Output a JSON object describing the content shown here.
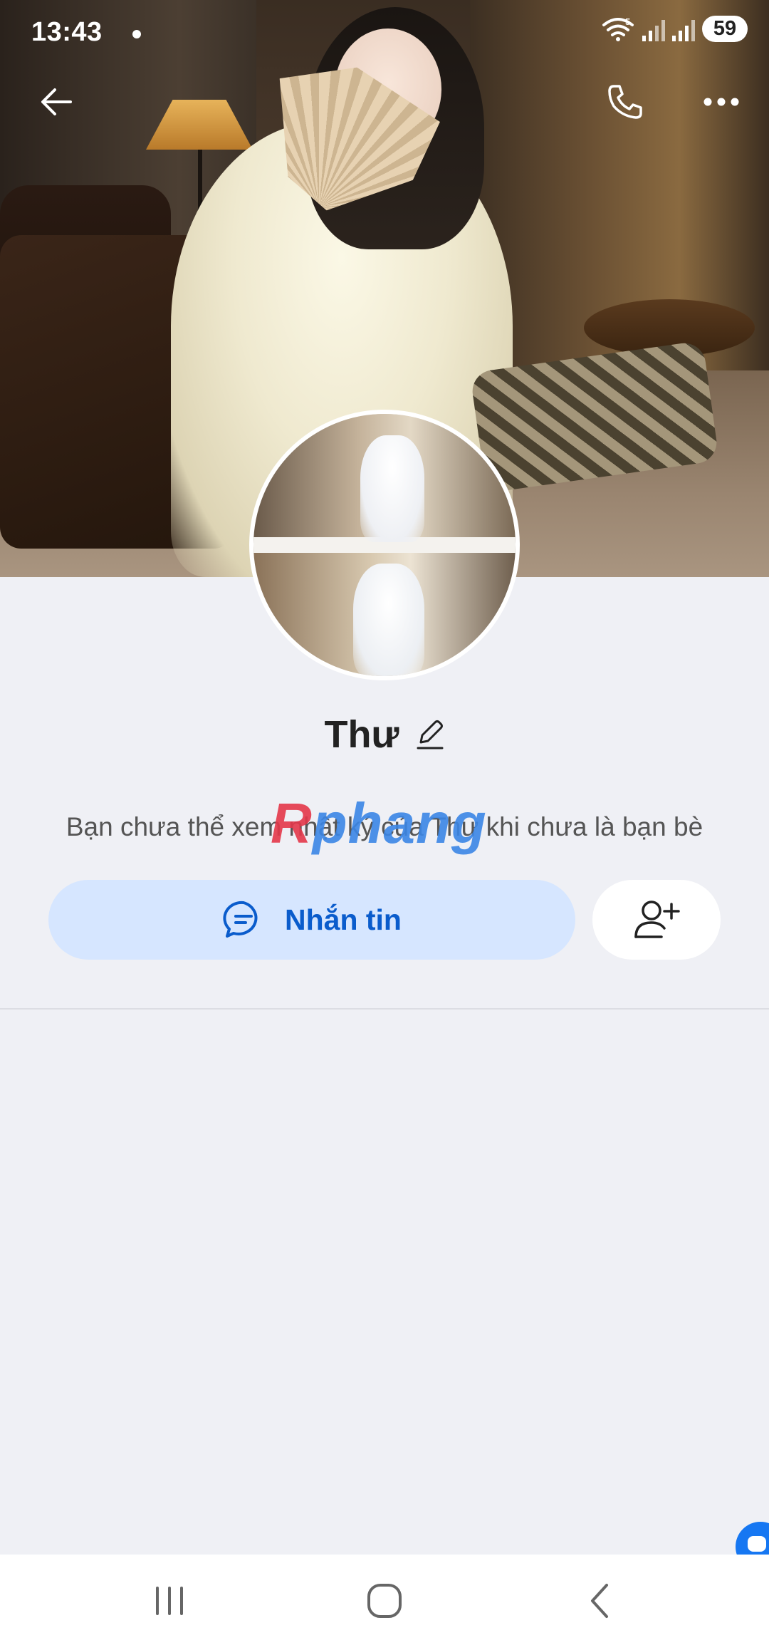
{
  "status_bar": {
    "time": "13:43",
    "battery": "59",
    "wifi_badge": "5"
  },
  "profile": {
    "name": "Thư",
    "notice": "Bạn chưa thể xem nhật ký của Thư khi chưa là bạn bè"
  },
  "actions": {
    "message_label": "Nhắn tin"
  },
  "watermark": {
    "first": "R",
    "rest": "phang"
  },
  "colors": {
    "accent": "#0a5ccc",
    "message_button_bg": "#d6e6ff",
    "page_bg": "#eff0f5"
  },
  "icons": [
    "back-arrow-icon",
    "phone-icon",
    "more-dots-icon",
    "edit-pencil-icon",
    "chat-bubble-icon",
    "add-friend-icon",
    "recent-apps-icon",
    "home-icon",
    "nav-back-icon"
  ]
}
